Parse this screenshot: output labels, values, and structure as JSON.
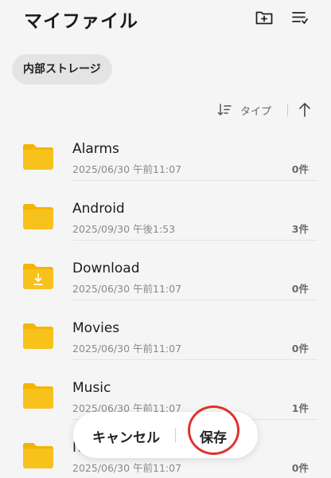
{
  "header": {
    "title": "マイファイル"
  },
  "breadcrumb": {
    "location": "内部ストレージ"
  },
  "sort": {
    "label": "タイプ"
  },
  "folders": [
    {
      "name": "Alarms",
      "date": "2025/06/30 午前11:07",
      "count": "0件",
      "icon": "folder-icon"
    },
    {
      "name": "Android",
      "date": "2025/09/30 午後1:53",
      "count": "3件",
      "icon": "folder-icon"
    },
    {
      "name": "Download",
      "date": "2025/06/30 午前11:07",
      "count": "0件",
      "icon": "download-folder-icon"
    },
    {
      "name": "Movies",
      "date": "2025/06/30 午前11:07",
      "count": "0件",
      "icon": "folder-icon"
    },
    {
      "name": "Music",
      "date": "2025/06/30 午前11:07",
      "count": "1件",
      "icon": "folder-icon"
    },
    {
      "name": "N",
      "date": "2025/06/30 午前11:07",
      "count": "0件",
      "icon": "folder-icon"
    }
  ],
  "actions": {
    "cancel": "キャンセル",
    "save": "保存"
  },
  "colors": {
    "folder": "#f8c21d",
    "folder_tab": "#f5b400",
    "highlight_ring": "#e0322f",
    "background": "#f5f5f5"
  }
}
